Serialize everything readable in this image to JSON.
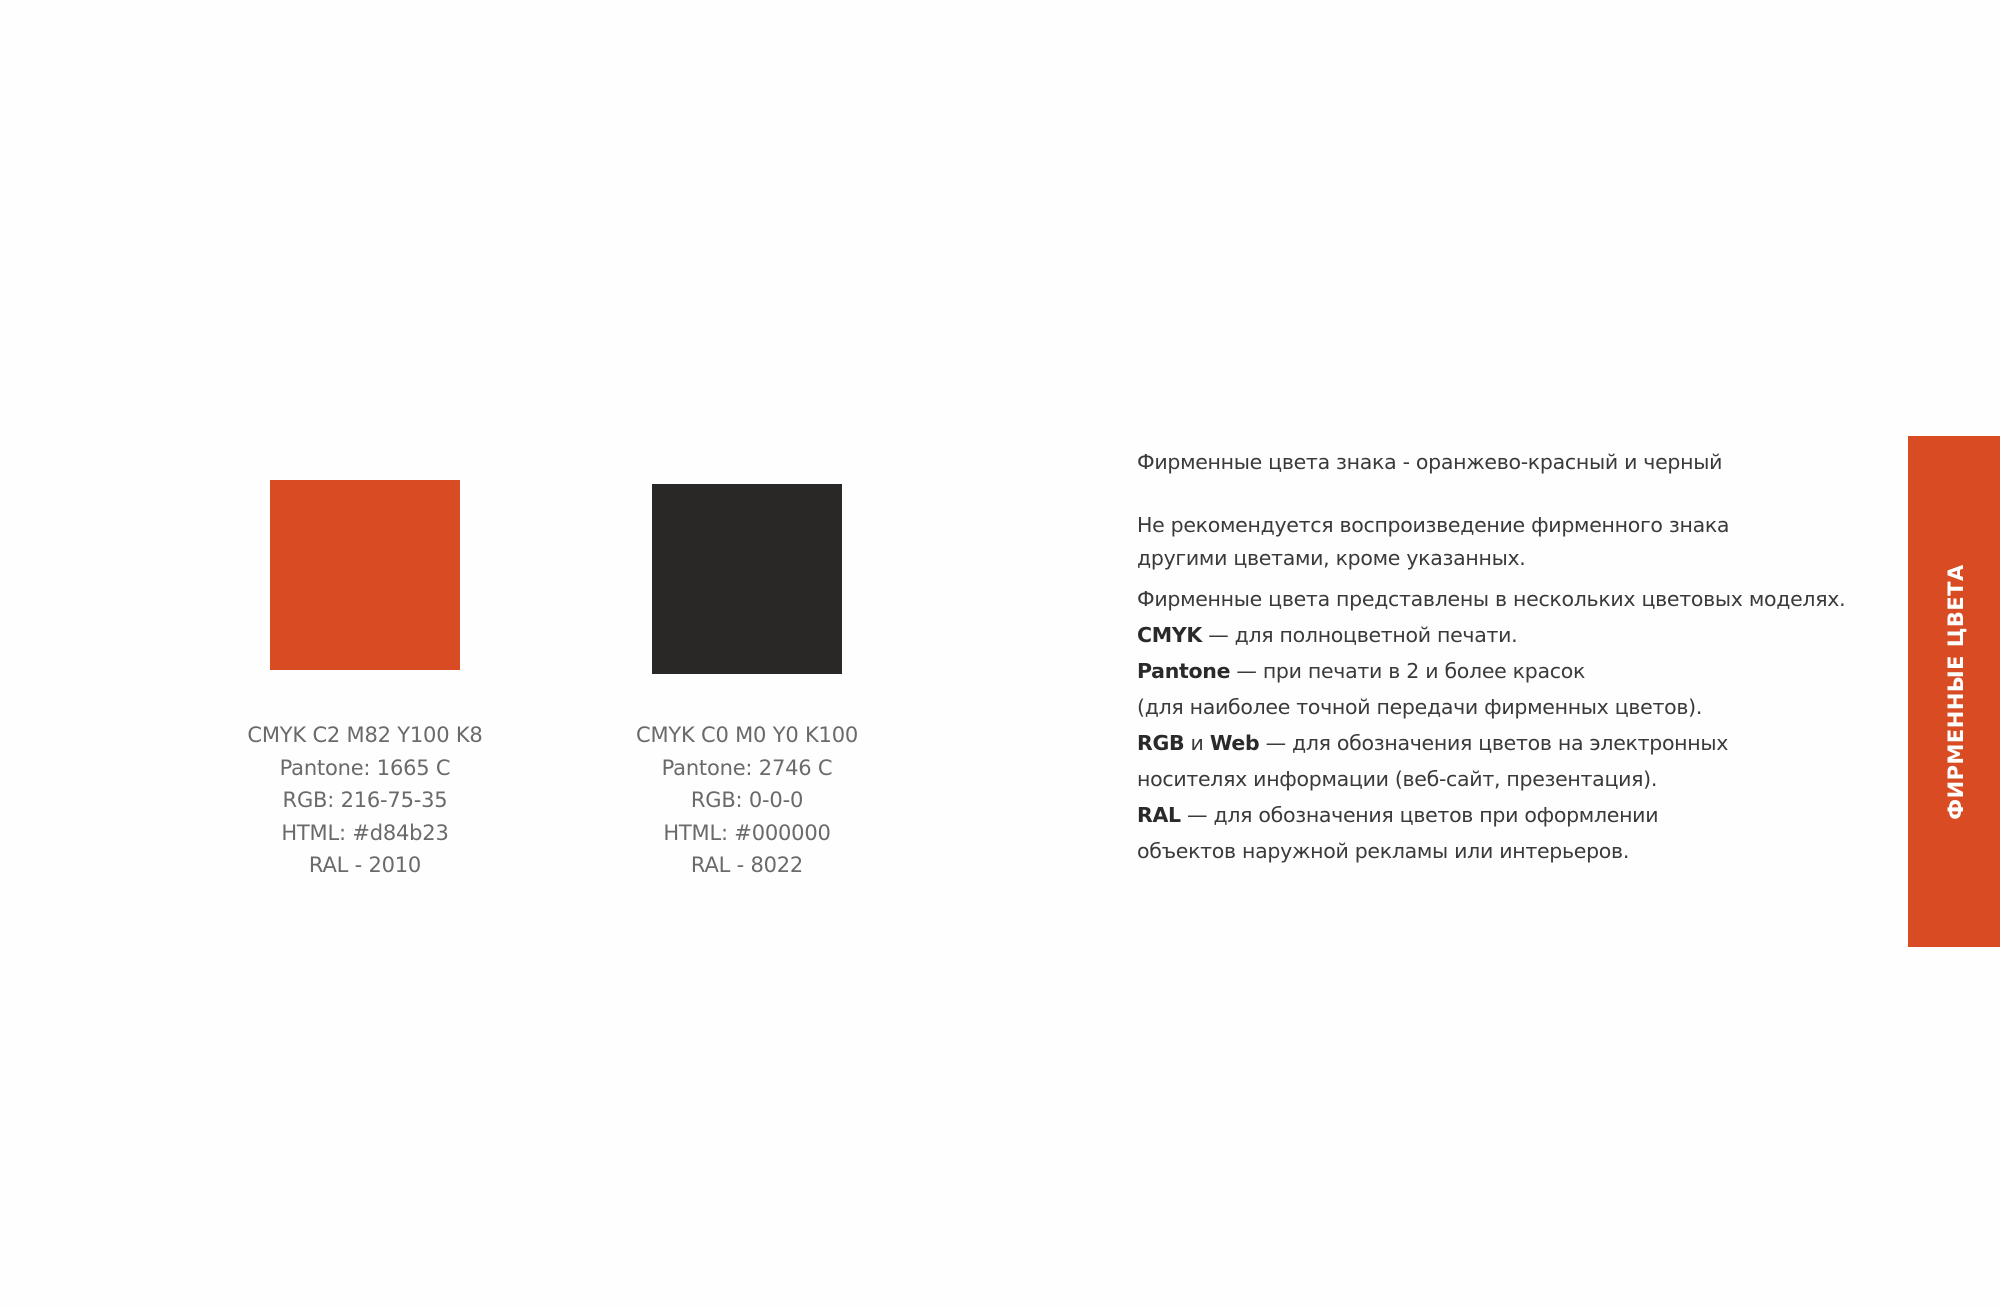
{
  "colors": {
    "brand_orange": "#d84b23",
    "brand_black": "#292826"
  },
  "swatches": [
    {
      "name": "orange-red",
      "color": "#d84b23",
      "specs": [
        "CMYK C2 M82 Y100 K8",
        "Pantone: 1665 C",
        "RGB: 216-75-35",
        "HTML: #d84b23",
        "RAL - 2010"
      ]
    },
    {
      "name": "black",
      "color": "#292826",
      "specs": [
        "CMYK C0 M0 Y0 K100",
        "Pantone: 2746 C",
        "RGB: 0-0-0",
        "HTML: #000000",
        "RAL - 8022"
      ]
    }
  ],
  "description": {
    "heading": "Фирменные цвета знака - оранжево-красный и черный",
    "recommend_line1": "Не рекомендуется воспроизведение фирменного знака",
    "recommend_line2": "другими цветами, кроме указанных.",
    "models_intro": "Фирменные цвета представлены в нескольких цветовых моделях.",
    "cmyk_term": "CMYK",
    "cmyk_text": " — для полноцветной печати.",
    "pantone_term": "Pantone",
    "pantone_text": " —  при печати в 2 и более красок",
    "pantone_text2": "(для наиболее точной передачи фирменных цветов).",
    "rgb_term": "RGB",
    "and_word": " и ",
    "web_term": "Web",
    "rgb_text": " —  для обозначения цветов на электронных",
    "rgb_text2": "носителях информации (веб-сайт, презентация).",
    "ral_term": "RAL",
    "ral_text": "  —  для обозначения цветов при оформлении",
    "ral_text2": "объектов наружной рекламы или интерьеров."
  },
  "side_tab": {
    "label": "ФИРМЕННЫЕ ЦВЕТА"
  }
}
